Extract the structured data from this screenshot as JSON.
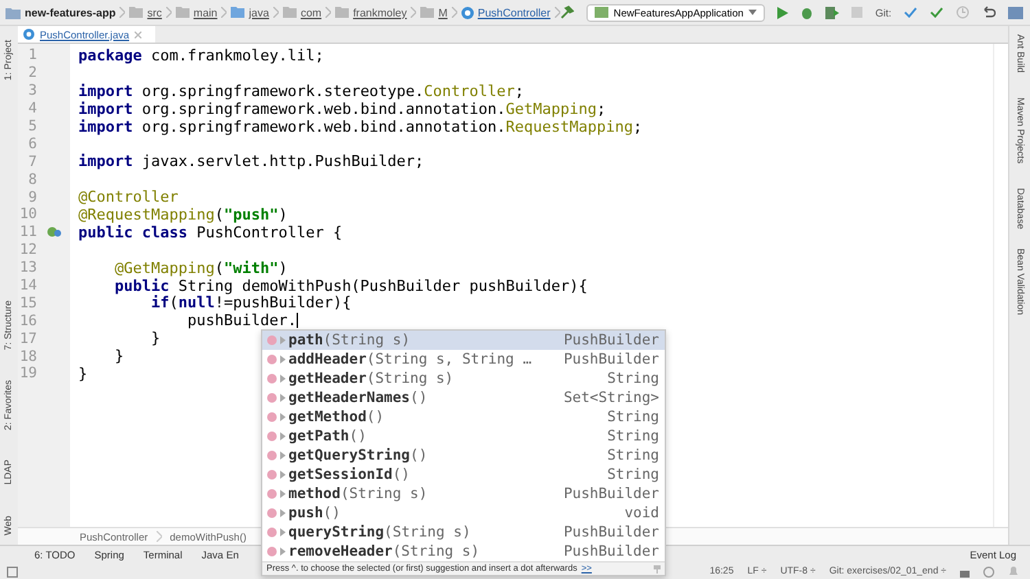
{
  "breadcrumbs": [
    {
      "label": "new-features-app",
      "kind": "project"
    },
    {
      "label": "src",
      "kind": "folder"
    },
    {
      "label": "main",
      "kind": "folder"
    },
    {
      "label": "java",
      "kind": "source"
    },
    {
      "label": "com",
      "kind": "folder"
    },
    {
      "label": "frankmoley",
      "kind": "folder"
    },
    {
      "label": "M",
      "kind": "folder"
    },
    {
      "label": "PushController",
      "kind": "class"
    }
  ],
  "run_config": "NewFeaturesAppApplication",
  "git_label": "Git:",
  "tabs": [
    {
      "label": "PushController.java",
      "selected": true
    }
  ],
  "left_tools": [
    "1: Project",
    "7: Structure",
    "2: Favorites",
    "LDAP",
    "Web"
  ],
  "right_tools": [
    "Ant Build",
    "Maven Projects",
    "Database",
    "Bean Validation"
  ],
  "lines": [
    {
      "number": "1",
      "tokens": [
        {
          "text": "package",
          "kind": "kw"
        },
        {
          "text": " com.frankmoley.lil;",
          "kind": "plain"
        }
      ]
    },
    {
      "number": "2"
    },
    {
      "number": "3",
      "tokens": [
        {
          "text": "import",
          "kind": "kw"
        },
        {
          "text": " org.springframework.stereotype.",
          "kind": "plain"
        },
        {
          "text": "Controller",
          "kind": "ann"
        },
        {
          "text": ";",
          "kind": "plain"
        }
      ]
    },
    {
      "number": "4",
      "tokens": [
        {
          "text": "import",
          "kind": "kw"
        },
        {
          "text": " org.springframework.web.bind.annotation.",
          "kind": "plain"
        },
        {
          "text": "GetMapping",
          "kind": "ann"
        },
        {
          "text": ";",
          "kind": "plain"
        }
      ]
    },
    {
      "number": "5",
      "tokens": [
        {
          "text": "import",
          "kind": "kw"
        },
        {
          "text": " org.springframework.web.bind.annotation.",
          "kind": "plain"
        },
        {
          "text": "RequestMapping",
          "kind": "ann"
        },
        {
          "text": ";",
          "kind": "plain"
        }
      ]
    },
    {
      "number": "6"
    },
    {
      "number": "7",
      "tokens": [
        {
          "text": "import",
          "kind": "kw"
        },
        {
          "text": " javax.servlet.http.PushBuilder;",
          "kind": "plain"
        }
      ]
    },
    {
      "number": "8"
    },
    {
      "number": "9",
      "tokens": [
        {
          "text": "@Controller",
          "kind": "ann"
        }
      ]
    },
    {
      "number": "10",
      "tokens": [
        {
          "text": "@RequestMapping",
          "kind": "ann"
        },
        {
          "text": "(",
          "kind": "plain"
        },
        {
          "text": "\"push\"",
          "kind": "str"
        },
        {
          "text": ")",
          "kind": "plain"
        }
      ]
    },
    {
      "number": "11",
      "bean_marker": true,
      "tokens": [
        {
          "text": "public class",
          "kind": "kw"
        },
        {
          "text": " PushController {",
          "kind": "plain"
        }
      ]
    },
    {
      "number": "12"
    },
    {
      "number": "13",
      "tokens": [
        {
          "text": "    @GetMapping",
          "kind": "ann"
        },
        {
          "text": "(",
          "kind": "plain"
        },
        {
          "text": "\"with\"",
          "kind": "str"
        },
        {
          "text": ")",
          "kind": "plain"
        }
      ]
    },
    {
      "number": "14",
      "tokens": [
        {
          "text": "    public",
          "kind": "kw"
        },
        {
          "text": " String demoWithPush(PushBuilder pushBuilder){",
          "kind": "plain"
        }
      ]
    },
    {
      "number": "15",
      "tokens": [
        {
          "text": "        if",
          "kind": "kw"
        },
        {
          "text": "(",
          "kind": "plain"
        },
        {
          "text": "null",
          "kind": "kw"
        },
        {
          "text": "!=pushBuilder){",
          "kind": "plain"
        }
      ]
    },
    {
      "number": "16",
      "caret": true,
      "tokens": [
        {
          "text": "            pushBuilder.",
          "kind": "plain"
        }
      ]
    },
    {
      "number": "17",
      "tokens": [
        {
          "text": "        }",
          "kind": "plain"
        }
      ]
    },
    {
      "number": "18",
      "tokens": [
        {
          "text": "    }",
          "kind": "plain"
        }
      ]
    },
    {
      "number": "19",
      "tokens": [
        {
          "text": "}",
          "kind": "plain"
        }
      ]
    }
  ],
  "completion": {
    "items": [
      {
        "name": "path",
        "params": "(String s)",
        "type": "PushBuilder",
        "selected": true
      },
      {
        "name": "addHeader",
        "params": "(String s, String …",
        "type": "PushBuilder",
        "selected": false
      },
      {
        "name": "getHeader",
        "params": "(String s)",
        "type": "String",
        "selected": false
      },
      {
        "name": "getHeaderNames",
        "params": "()",
        "type": "Set<String>",
        "selected": false
      },
      {
        "name": "getMethod",
        "params": "()",
        "type": "String",
        "selected": false
      },
      {
        "name": "getPath",
        "params": "()",
        "type": "String",
        "selected": false
      },
      {
        "name": "getQueryString",
        "params": "()",
        "type": "String",
        "selected": false
      },
      {
        "name": "getSessionId",
        "params": "()",
        "type": "String",
        "selected": false
      },
      {
        "name": "method",
        "params": "(String s)",
        "type": "PushBuilder",
        "selected": false
      },
      {
        "name": "push",
        "params": "()",
        "type": "void",
        "selected": false
      },
      {
        "name": "queryString",
        "params": "(String s)",
        "type": "PushBuilder",
        "selected": false
      },
      {
        "name": "removeHeader",
        "params": "(String s)",
        "type": "PushBuilder",
        "selected": false
      }
    ],
    "hint": "Press ^. to choose the selected (or first) suggestion and insert a dot afterwards",
    "hint_link": ">>"
  },
  "code_breadcrumbs": [
    "PushController",
    "demoWithPush()"
  ],
  "bottom_tools": [
    "6: TODO",
    "Spring",
    "Terminal",
    "Java En"
  ],
  "event_log": "Event Log",
  "status_bar": [
    "16:25",
    "LF ÷",
    "UTF-8 ÷",
    "Git: exercises/02_01_end ÷"
  ]
}
